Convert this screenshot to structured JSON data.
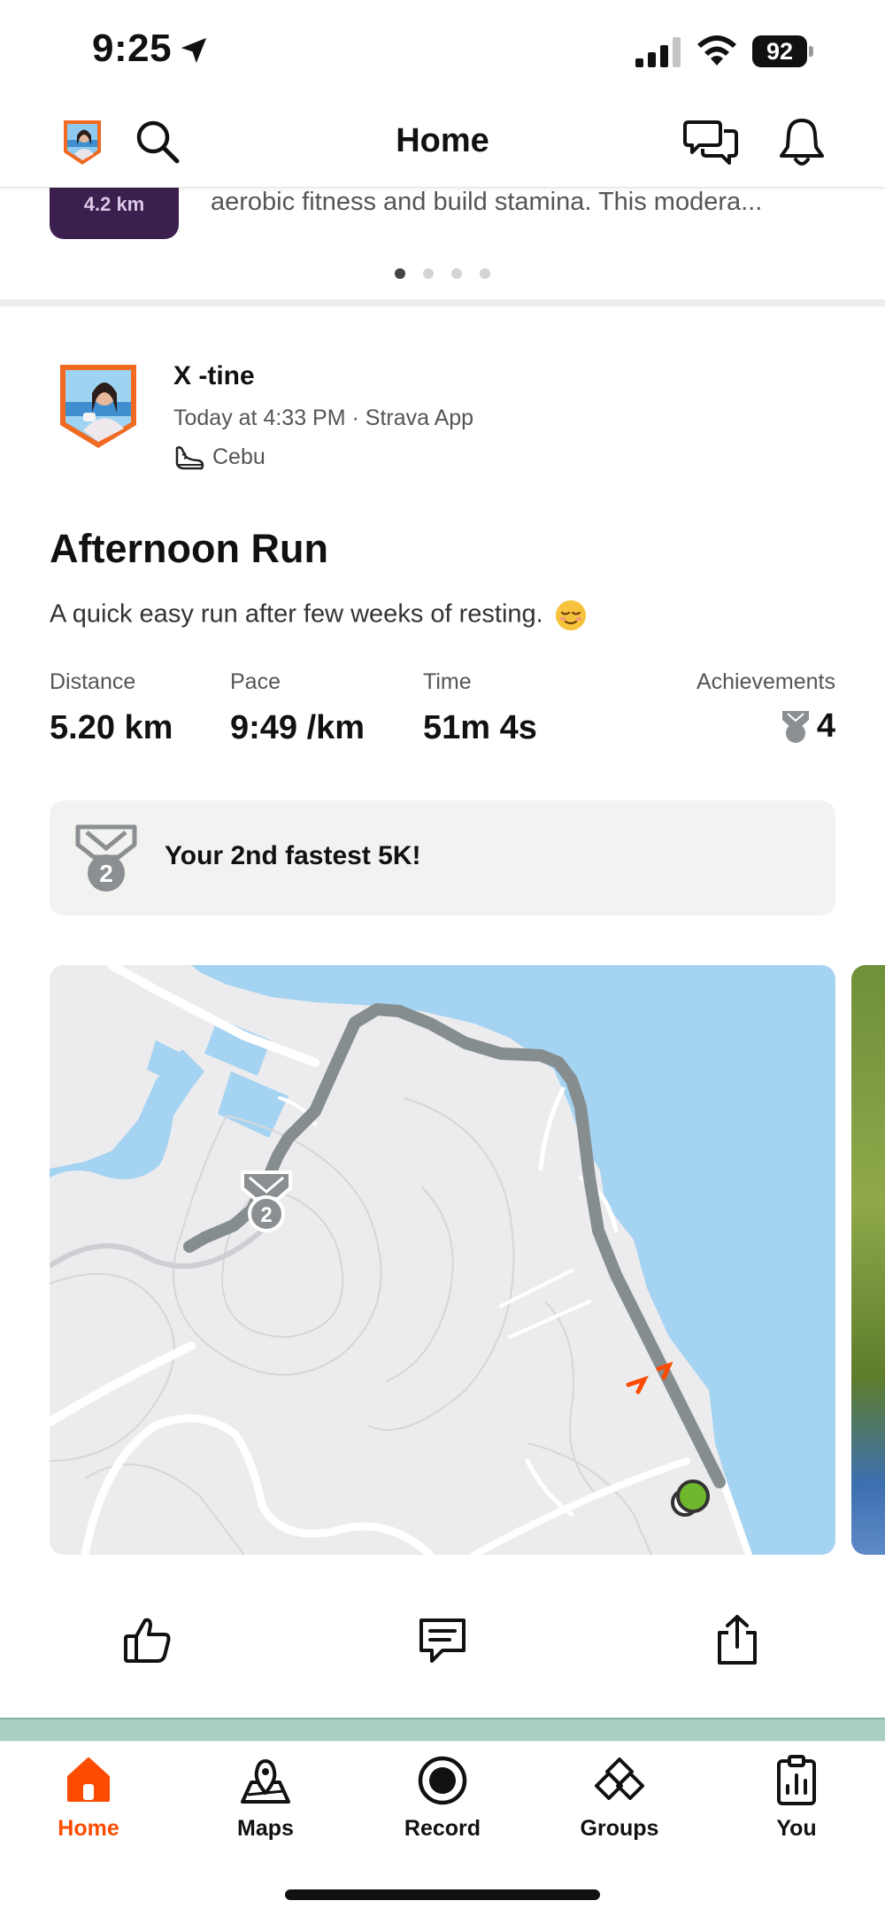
{
  "status_bar": {
    "time": "9:25",
    "battery": "92"
  },
  "header": {
    "title": "Home"
  },
  "carousel": {
    "badge_text": "4.2 km",
    "text": "aerobic fitness and build stamina. This modera...",
    "dot_count": 4,
    "active_dot": 0
  },
  "activity": {
    "athlete_name": "X -tine",
    "meta": "Today at 4:33 PM · Strava App",
    "location": "Cebu",
    "title": "Afternoon Run",
    "description": "A quick easy run after few weeks of resting.",
    "stats": [
      {
        "label": "Distance",
        "value": "5.20 km"
      },
      {
        "label": "Pace",
        "value": "9:49 /km"
      },
      {
        "label": "Time",
        "value": "51m 4s"
      }
    ],
    "achievements": {
      "label": "Achievements",
      "count": "4"
    },
    "highlight": {
      "text": "Your 2nd fastest 5K!",
      "medal_rank": "2"
    },
    "map_medal_rank": "2"
  },
  "tabs": [
    {
      "label": "Home",
      "icon": "home-icon",
      "active": true
    },
    {
      "label": "Maps",
      "icon": "maps-icon",
      "active": false
    },
    {
      "label": "Record",
      "icon": "record-icon",
      "active": false
    },
    {
      "label": "Groups",
      "icon": "groups-icon",
      "active": false
    },
    {
      "label": "You",
      "icon": "you-icon",
      "active": false
    }
  ],
  "colors": {
    "accent": "#fc4c02",
    "route": "#858d8f",
    "water": "#a5d3f2",
    "land": "#ececee",
    "start_marker": "#6fb82e"
  }
}
